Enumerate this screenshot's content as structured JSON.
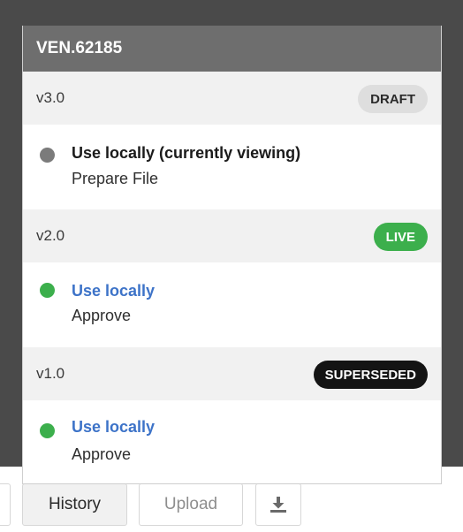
{
  "panel": {
    "title": "VEN.62185",
    "versions": [
      {
        "label": "v3.0",
        "status": "DRAFT",
        "action": "Use locally (currently viewing)",
        "step": "Prepare File"
      },
      {
        "label": "v2.0",
        "status": "LIVE",
        "action": "Use locally",
        "step": "Approve"
      },
      {
        "label": "v1.0",
        "status": "SUPERSEDED",
        "action": "Use locally",
        "step": "Approve"
      }
    ]
  },
  "toolbar": {
    "history_label": "History",
    "upload_label": "Upload",
    "download_icon": "download-icon"
  },
  "colors": {
    "live": "#3caf4c",
    "superseded": "#141414",
    "draft": "#dedede",
    "link": "#3d73c8",
    "header": "#6e6e6e"
  }
}
